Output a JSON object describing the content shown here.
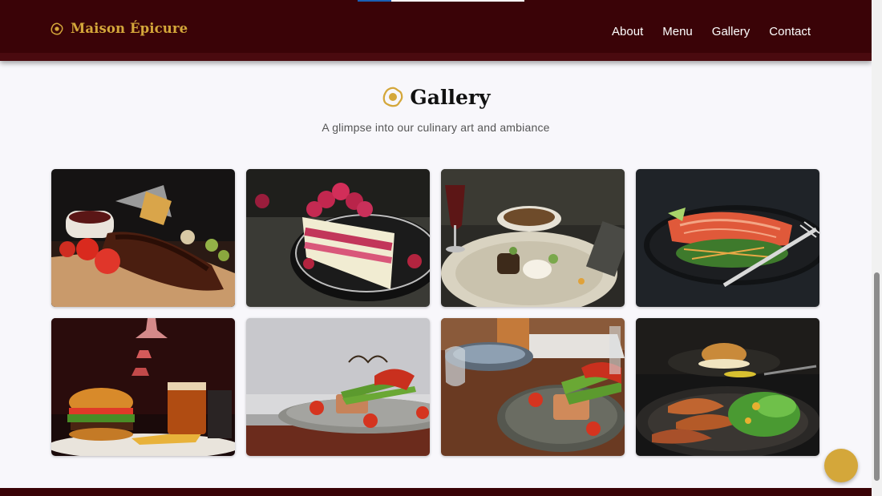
{
  "brand": {
    "name": "Maison Épicure",
    "icon": "fried-egg-icon",
    "color": "#d4a73a"
  },
  "nav": {
    "items": [
      "About",
      "Menu",
      "Gallery",
      "Contact"
    ]
  },
  "scroll_progress": 0.2,
  "gallery": {
    "title": "Gallery",
    "title_icon": "fried-egg-icon",
    "subtitle": "A glimpse into our culinary art and ambiance",
    "images": [
      {
        "subject": "bbq-ribs-with-tomatoes-and-fries"
      },
      {
        "subject": "raspberry-layer-cake-slice"
      },
      {
        "subject": "fine-dining-plate-with-wine"
      },
      {
        "subject": "grilled-salmon-with-salad"
      },
      {
        "subject": "burger-fries-and-beer"
      },
      {
        "subject": "salmon-with-asparagus-side-view"
      },
      {
        "subject": "salmon-with-asparagus-table-setting"
      },
      {
        "subject": "sweet-potatoes-and-greens-dark-plate"
      }
    ]
  },
  "colors": {
    "header": "#3a0307",
    "accent": "#d4a73a",
    "background": "#f8f7fb"
  },
  "floating_button": {
    "icon": "circle-button"
  }
}
